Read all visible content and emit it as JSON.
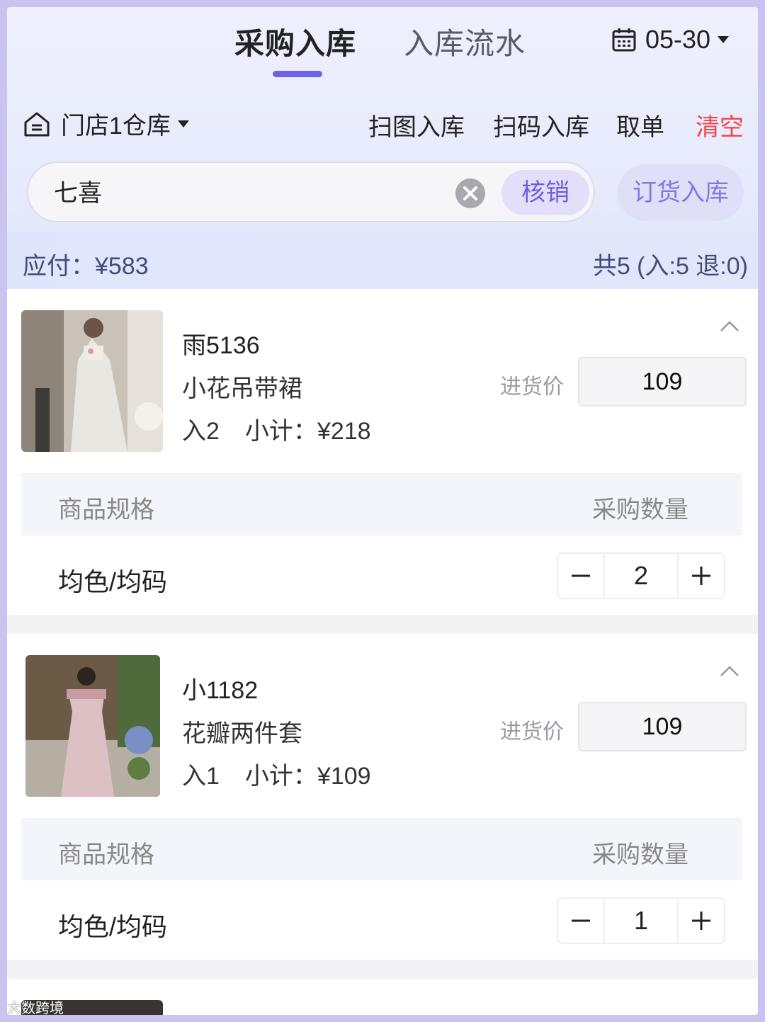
{
  "header": {
    "tabs": [
      {
        "label": "采购入库",
        "active": true
      },
      {
        "label": "入库流水",
        "active": false
      }
    ],
    "date": "05-30"
  },
  "toolbar": {
    "store": "门店1仓库",
    "actions": [
      {
        "label": "扫图入库"
      },
      {
        "label": "扫码入库"
      },
      {
        "label": "取单"
      },
      {
        "label": "清空"
      }
    ]
  },
  "search": {
    "value": "七喜",
    "verify_label": "核销",
    "order_label": "订货入库"
  },
  "summary": {
    "payable": "应付：¥583",
    "count": "共5 (入:5 退:0)"
  },
  "items": [
    {
      "code": "雨5136",
      "name": "小花吊带裙",
      "in_qty": "入2",
      "subtotal": "小计：¥218",
      "price_label": "进货价",
      "price": "109",
      "spec_header_left": "商品规格",
      "spec_header_right": "采购数量",
      "spec": "均色/均码",
      "quantity": "2"
    },
    {
      "code": "小1182",
      "name": "花瓣两件套",
      "in_qty": "入1",
      "subtotal": "小计：¥109",
      "price_label": "进货价",
      "price": "109",
      "spec_header_left": "商品规格",
      "spec_header_right": "采购数量",
      "spec": "均色/均码",
      "quantity": "1"
    }
  ],
  "watermark": "大数跨境",
  "colors": {
    "accent": "#6e62e8",
    "danger": "#f04447",
    "summary_text": "#434b78"
  }
}
